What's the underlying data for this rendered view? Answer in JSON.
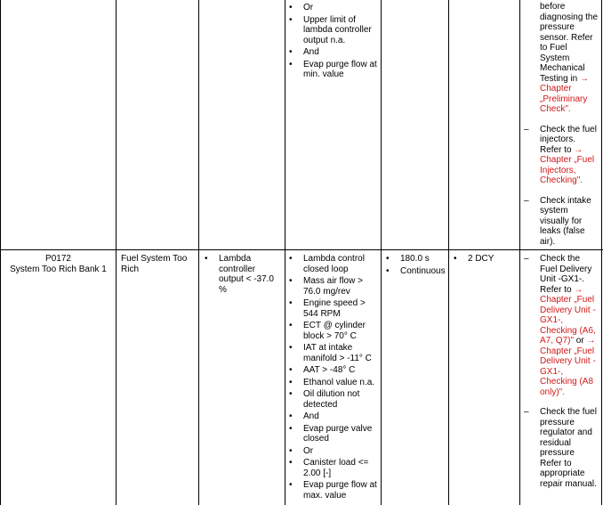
{
  "row1": {
    "conditions": [
      "Or",
      "Upper limit of lambda controller output n.a.",
      "And",
      "Evap purge flow at min. value"
    ],
    "actions": [
      {
        "pre_fragment_text": "before diagnosing the pressure sensor. Refer to Fuel System Mechanical Testing in",
        "link": "→ Chapter „Preliminary Check\".",
        "post": ""
      },
      {
        "pre_fragment_text": "Check the fuel injectors. Refer to",
        "link": "→ Chapter „Fuel Injectors, Checking\".",
        "post": ""
      },
      {
        "pre_fragment_text": "Check intake system visually for leaks (false air).",
        "link": "",
        "post": ""
      }
    ]
  },
  "row2": {
    "dtc_code": "P0172",
    "dtc_desc": "System Too Rich Bank 1",
    "fault": "Fuel System Too Rich",
    "threshold": "Lambda controller output < -37.0 %",
    "conditions": [
      "Lambda control closed loop",
      "Mass air flow > 76.0 mg/rev",
      "Engine speed > 544 RPM",
      "ECT @ cylinder block > 70° C",
      "IAT at intake manifold > -11° C",
      "AAT > -48° C",
      "Ethanol value n.a.",
      "Oil dilution not detected",
      "And",
      "Evap purge valve closed",
      "Or",
      "Canister load <= 2.00 [-]",
      "Evap purge flow at max. value"
    ],
    "time": [
      "180.0 s",
      "Continuous"
    ],
    "mil": [
      "2 DCY"
    ],
    "actions": [
      {
        "pre_fragment_text": "Check the Fuel Delivery Unit -GX1-. Refer to",
        "link": "→ Chapter „Fuel Delivery Unit -GX1-, Checking (A6, A7, Q7)\"",
        "post": " or",
        "link2": "→ Chapter „Fuel Delivery Unit -GX1-, Checking (A8 only)\"."
      },
      {
        "pre_fragment_text": "Check the fuel pressure regulator and residual pressure Refer to appropriate repair manual.",
        "link": "",
        "post": ""
      }
    ]
  }
}
